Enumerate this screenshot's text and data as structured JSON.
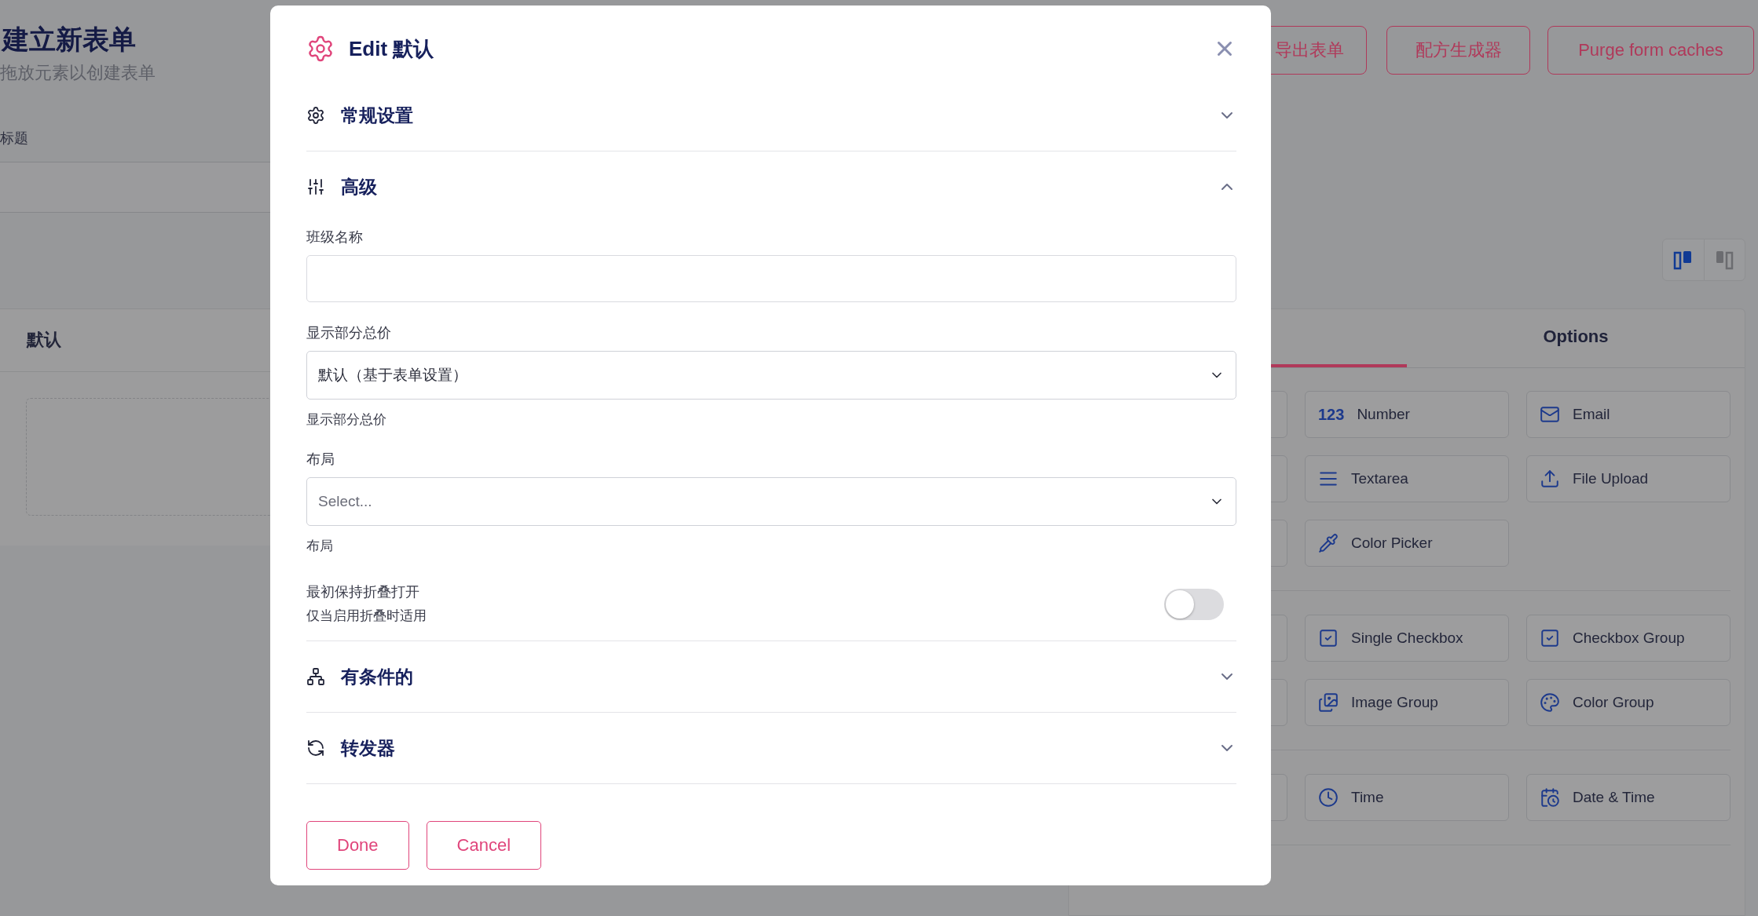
{
  "page": {
    "title": "建立新表单",
    "subtitle": "拖放元素以创建表单",
    "field_label": "标题",
    "section_title": "默认"
  },
  "header_buttons": [
    "导出表单",
    "配方生成器",
    "Purge form caches"
  ],
  "view_toggle": [
    {
      "kind": "builder",
      "selected": true
    },
    {
      "kind": "preview",
      "selected": false
    }
  ],
  "palette": {
    "tabs": [
      {
        "selected": true
      },
      {
        "label": "Options",
        "selected": false
      }
    ],
    "groups": [
      [
        {
          "kind": "number",
          "icon_text": "123",
          "label": "Number"
        },
        {
          "kind": "email",
          "label": "Email"
        },
        {
          "kind": "textarea",
          "label": "Textarea"
        },
        {
          "kind": "upload",
          "label": "File Upload"
        },
        {
          "kind": "picker",
          "label": "Color Picker"
        }
      ],
      [
        {
          "kind": "checkbox",
          "label": "Single Checkbox"
        },
        {
          "kind": "checkbox",
          "label": "Checkbox Group"
        },
        {
          "kind": "images",
          "label": "Image Group"
        },
        {
          "kind": "palette",
          "label": "Color Group"
        }
      ],
      [
        {
          "kind": "time",
          "label": "Time"
        },
        {
          "kind": "datetime",
          "label": "Date & Time"
        }
      ]
    ]
  },
  "modal": {
    "title": "Edit 默认",
    "actions": [
      {
        "label": "Done"
      },
      {
        "label": "Cancel"
      }
    ],
    "sections": [
      {
        "kind": "general",
        "title": "常规设置",
        "expanded": false
      },
      {
        "kind": "advanced",
        "title": "高级",
        "expanded": true,
        "fields": [
          {
            "kind": "text",
            "label": "班级名称"
          },
          {
            "kind": "select",
            "label": "显示部分总价",
            "value": "默认（基于表单设置）",
            "help": "显示部分总价"
          },
          {
            "kind": "select",
            "label": "布局",
            "placeholder": "Select...",
            "help": "布局"
          },
          {
            "kind": "toggle",
            "label": "最初保持折叠打开",
            "description": "仅当启用折叠时适用",
            "on": false
          }
        ]
      },
      {
        "kind": "conditional",
        "title": "有条件的",
        "expanded": false
      },
      {
        "kind": "repeater",
        "title": "转发器",
        "expanded": false
      }
    ]
  }
}
